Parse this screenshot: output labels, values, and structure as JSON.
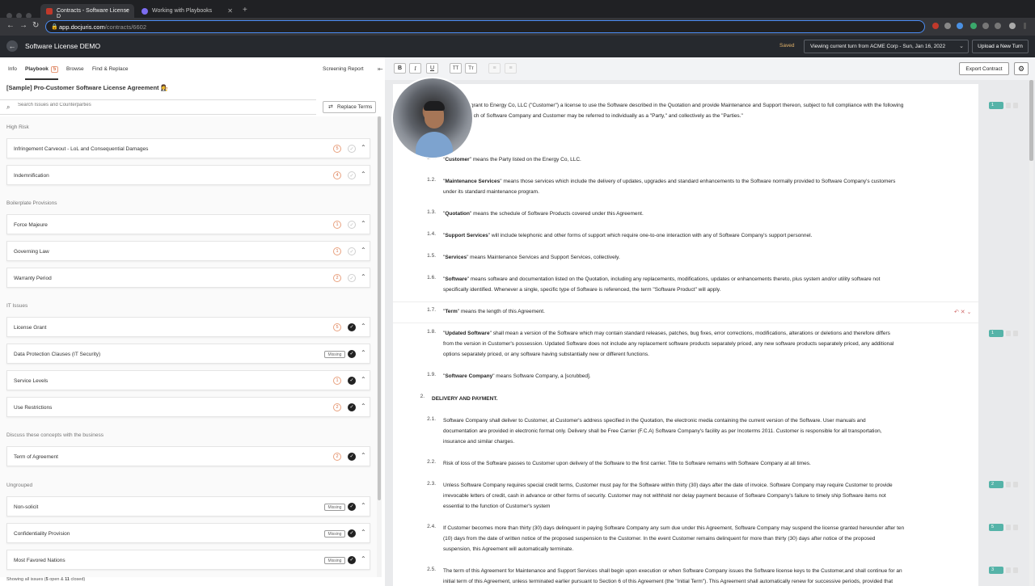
{
  "browser": {
    "tabs": [
      {
        "title": "Contracts - Software License D"
      },
      {
        "title": "Working with Playbooks"
      }
    ],
    "url_host": "app.docjuris.com",
    "url_path": "/contracts/6602"
  },
  "header": {
    "title": "Software License DEMO",
    "saved": "Saved",
    "turn_select": "Viewing current turn from ACME Corp - Sun, Jan 16, 2022",
    "upload_button": "Upload a New Turn"
  },
  "left_tabs": {
    "info": "Info",
    "playbook": "Playbook",
    "playbook_count": "5",
    "browse": "Browse",
    "find_replace": "Find & Replace",
    "screening_report": "Screening Report"
  },
  "contract_title": "[Sample] Pro-Customer Software License Agreement 👩‍⚖️",
  "search": {
    "placeholder": "Search Issues and Counterparties"
  },
  "replace_terms": "Replace Terms",
  "groups": [
    {
      "label": "High Risk"
    },
    {
      "label": "Boilerplate Provisions"
    },
    {
      "label": "IT Issues"
    },
    {
      "label": "Discuss these concepts with the business"
    },
    {
      "label": "Ungrouped"
    }
  ],
  "issues": [
    {
      "label": "Infringement Carveout - LoL and Consequential Damages",
      "count": "5",
      "missing": "",
      "done": false
    },
    {
      "label": "Indemnification",
      "count": "4",
      "missing": "",
      "done": false
    },
    {
      "label": "Force Majeure",
      "count": "1",
      "missing": "",
      "done": false
    },
    {
      "label": "Governing Law",
      "count": "1",
      "missing": "",
      "done": false
    },
    {
      "label": "Warranty Period",
      "count": "2",
      "missing": "",
      "done": false
    },
    {
      "label": "License Grant",
      "count": "5",
      "missing": "",
      "done": true
    },
    {
      "label": "Data Protection Clauses (IT Security)",
      "count": "",
      "missing": "Missing",
      "done": true
    },
    {
      "label": "Service Levels",
      "count": "1",
      "missing": "",
      "done": true
    },
    {
      "label": "Use Restrictions",
      "count": "2",
      "missing": "",
      "done": true
    },
    {
      "label": "Term of Agreement",
      "count": "2",
      "missing": "",
      "done": true
    },
    {
      "label": "Non-solicit",
      "count": "",
      "missing": "Missing",
      "done": true
    },
    {
      "label": "Confidentiality Provision",
      "count": "",
      "missing": "Missing",
      "done": true
    },
    {
      "label": "Most Favored Nations",
      "count": "",
      "missing": "Missing",
      "done": true
    }
  ],
  "footer": {
    "prefix": "Showing all issues (",
    "open": "5",
    "mid": " open & ",
    "closed": "11",
    "suffix": " closed)"
  },
  "toolbar": {
    "bold": "B",
    "italic": "I",
    "underline": "U",
    "tt1": "TT",
    "tt2": "Tт",
    "export": "Export Contract"
  },
  "document": {
    "intro1": "grant to Energy Co, LLC (\"Customer\") a license to use the Software described in the Quotation and provide Maintenance and Support thereon, subject to full compliance with the following",
    "intro2": "ach of Software Company and Customer may be referred to individually as a \"Party,\" and collectively as the \"Parties.\"",
    "defs": [
      {
        "num": "1.1.",
        "term": "Customer",
        "text": "\" means the Party listed on the Energy Co, LLC.",
        "cont": ""
      },
      {
        "num": "1.2.",
        "term": "Maintenance Services",
        "text": "\" means those services which include the delivery of updates, upgrades and standard enhancements to the Software normally provided to Software Company's customers",
        "cont": "under its standard maintenance program."
      },
      {
        "num": "1.3.",
        "term": "Quotation",
        "text": "\" means the schedule of Software Products covered under this Agreement.",
        "cont": ""
      },
      {
        "num": "1.4.",
        "term": "Support Services",
        "text": "\" will include telephonic and other forms of support which require one-to-one interaction with any of Software Company's support personnel.",
        "cont": ""
      },
      {
        "num": "1.5.",
        "term": "Services",
        "text": "\" means Maintenance Services and Support Services, collectively.",
        "cont": ""
      },
      {
        "num": "1.6.",
        "term": "Software",
        "text": "\" means software and documentation listed on the Quotation, including any replacements, modifications, updates or enhancements thereto, plus system and/or utility software not",
        "cont": "specifically identified.  Whenever a single, specific type of Software is referenced, the term \"Software Product\" will apply."
      },
      {
        "num": "1.7.",
        "term": "Term",
        "text": "\" means the length of this Agreement.",
        "cont": ""
      },
      {
        "num": "1.8.",
        "term": "Updated Software",
        "text": "\" shall mean a version of the Software which may contain standard releases, patches, bug fixes, error corrections, modifications, alterations or deletions and therefore differs",
        "cont": "from the version in Customer's possession. Updated Software does not include any replacement software products separately priced, any new software products separately priced, any additional"
      },
      {
        "num": "1.9.",
        "term": "Software Company",
        "text": "\" means Software Company, a [scrubbed].",
        "cont": ""
      }
    ],
    "def18_line3": "options separately priced, or any software having substantially new or different functions.",
    "section2": "DELIVERY AND PAYMENT.",
    "section2_num": "2.",
    "p21_num": "2.1.",
    "p21": [
      "Software Company shall deliver to Customer, at Customer's address specified in the Quotation, the electronic media containing the current version of the Software.  User manuals and",
      "documentation are provided in electronic format only.  Delivery shall be Free Carrier (F.C.A) Software Company's facility as per Incoterms 2011.  Customer is responsible for all transportation,",
      "insurance and similar charges."
    ],
    "p22_num": "2.2.",
    "p22": [
      "Risk of loss of the Software passes to Customer upon delivery of the Software to the first carrier.  Title to Software remains with Software Company at all times."
    ],
    "p23_num": "2.3.",
    "p23": [
      "Unless Software Company requires special credit terms, Customer must pay for the Software within thirty (30) days after the date of invoice.  Software Company may require Customer to provide",
      "irrevocable letters of credit, cash in advance or other forms of security.  Customer may not withhold nor delay payment because of Software Company's failure to timely ship Software items not",
      "essential to the function of Customer's system"
    ],
    "p24_num": "2.4.",
    "p24": [
      "If Customer becomes more than thirty (30) days delinquent in paying Software Company any sum due under this Agreement, Software Company may suspend the license granted hereunder after ten",
      "(10) days from the date of written notice of the proposed suspension to the Customer.  In the event Customer remains delinquent for more than thirty (30) days after notice of the proposed",
      "suspension, this Agreement will automatically terminate."
    ],
    "p25_num": "2.5.",
    "p25": [
      "The term of this Agreement for Maintenance and Support Services shall begin upon execution or when Software Company issues the Software license keys to the Customer,and shall continue for an",
      "initial term of this Agreement, unless terminated earlier pursuant to Section 6 of this Agreement (the \"Initial Term\").  This Agreement shall automatically renew for successive periods, provided that"
    ]
  },
  "review_badges": [
    "1",
    "1",
    "2",
    "5",
    "3"
  ]
}
